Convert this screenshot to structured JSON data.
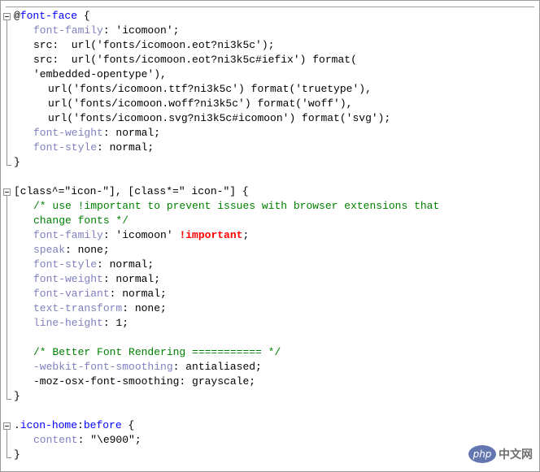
{
  "editor": {
    "lines": [
      [
        {
          "t": "@",
          "c": "plain"
        },
        {
          "t": "font-face",
          "c": "kw"
        },
        {
          "t": " {",
          "c": "plain"
        }
      ],
      [
        {
          "t": "font-family",
          "c": "prop",
          "i": 1
        },
        {
          "t": ": 'icomoon';",
          "c": "plain"
        }
      ],
      [
        {
          "t": "src:  url('fonts/icomoon.eot?ni3k5c');",
          "c": "plain",
          "i": 1
        }
      ],
      [
        {
          "t": "src:  url('fonts/icomoon.eot?ni3k5c#iefix') format(",
          "c": "plain",
          "i": 1
        }
      ],
      [
        {
          "t": "'embedded-opentype'),",
          "c": "plain",
          "i": 1
        }
      ],
      [
        {
          "t": "url('fonts/icomoon.ttf?ni3k5c') format('truetype'),",
          "c": "plain",
          "i": 2
        }
      ],
      [
        {
          "t": "url('fonts/icomoon.woff?ni3k5c') format('woff'),",
          "c": "plain",
          "i": 2
        }
      ],
      [
        {
          "t": "url('fonts/icomoon.svg?ni3k5c#icomoon') format('svg');",
          "c": "plain",
          "i": 2
        }
      ],
      [
        {
          "t": "font-weight",
          "c": "prop",
          "i": 1
        },
        {
          "t": ": normal;",
          "c": "plain"
        }
      ],
      [
        {
          "t": "font-style",
          "c": "prop",
          "i": 1
        },
        {
          "t": ": normal;",
          "c": "plain"
        }
      ],
      [
        {
          "t": "}",
          "c": "plain"
        }
      ],
      [
        {
          "t": "",
          "c": "plain"
        }
      ],
      [
        {
          "t": "[class^=\"icon-\"], [class*=\" icon-\"] {",
          "c": "plain"
        }
      ],
      [
        {
          "t": "/* use !important to prevent issues with browser extensions that",
          "c": "cmt",
          "i": 1
        }
      ],
      [
        {
          "t": "change fonts */",
          "c": "cmt",
          "i": 1
        }
      ],
      [
        {
          "t": "font-family",
          "c": "prop",
          "i": 1
        },
        {
          "t": ": 'icomoon' ",
          "c": "plain"
        },
        {
          "t": "!important",
          "c": "imp"
        },
        {
          "t": ";",
          "c": "plain"
        }
      ],
      [
        {
          "t": "speak",
          "c": "prop",
          "i": 1
        },
        {
          "t": ": none;",
          "c": "plain"
        }
      ],
      [
        {
          "t": "font-style",
          "c": "prop",
          "i": 1
        },
        {
          "t": ": normal;",
          "c": "plain"
        }
      ],
      [
        {
          "t": "font-weight",
          "c": "prop",
          "i": 1
        },
        {
          "t": ": normal;",
          "c": "plain"
        }
      ],
      [
        {
          "t": "font-variant",
          "c": "prop",
          "i": 1
        },
        {
          "t": ": normal;",
          "c": "plain"
        }
      ],
      [
        {
          "t": "text-transform",
          "c": "prop",
          "i": 1
        },
        {
          "t": ": none;",
          "c": "plain"
        }
      ],
      [
        {
          "t": "line-height",
          "c": "prop",
          "i": 1
        },
        {
          "t": ": 1;",
          "c": "plain"
        }
      ],
      [
        {
          "t": "",
          "c": "plain"
        }
      ],
      [
        {
          "t": "/* Better Font Rendering =========== */",
          "c": "cmt",
          "i": 1
        }
      ],
      [
        {
          "t": "-webkit-font-smoothing",
          "c": "prop",
          "i": 1
        },
        {
          "t": ": antialiased;",
          "c": "plain"
        }
      ],
      [
        {
          "t": "-moz-osx-font-smoothing: grayscale;",
          "c": "plain",
          "i": 1
        }
      ],
      [
        {
          "t": "}",
          "c": "plain"
        }
      ],
      [
        {
          "t": "",
          "c": "plain"
        }
      ],
      [
        {
          "t": ".",
          "c": "plain"
        },
        {
          "t": "icon-home",
          "c": "kw"
        },
        {
          "t": ":",
          "c": "plain"
        },
        {
          "t": "before",
          "c": "kw"
        },
        {
          "t": " {",
          "c": "plain"
        }
      ],
      [
        {
          "t": "content",
          "c": "prop",
          "i": 1
        },
        {
          "t": ": \"\\e900\";",
          "c": "plain"
        }
      ],
      [
        {
          "t": "}",
          "c": "plain"
        }
      ]
    ]
  },
  "watermark": {
    "badge": "php",
    "text": "中文网"
  },
  "colors": {
    "keyword": "#0000ff",
    "property": "#8080c0",
    "comment": "#008000",
    "important": "#ff0000"
  }
}
